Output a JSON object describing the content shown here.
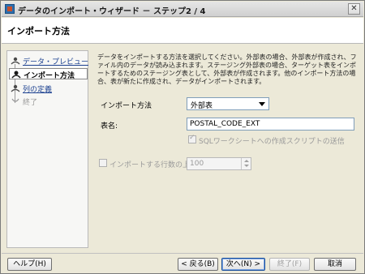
{
  "window": {
    "title": "データのインポート・ウィザード － ステップ2 / 4",
    "close_glyph": "✕"
  },
  "header": {
    "title": "インポート方法"
  },
  "steps": [
    {
      "label": "データ・プレビュー",
      "state": "link"
    },
    {
      "label": "インポート方法",
      "state": "current"
    },
    {
      "label": "列の定義",
      "state": "link"
    },
    {
      "label": "終了",
      "state": "disabled"
    }
  ],
  "content": {
    "description": "データをインポートする方法を選択してください。外部表の場合、外部表が作成され、ファイル内のデータが読み込まれます。ステージング外部表の場合、ターゲット表をインポートするためのステージング表として、外部表が作成されます。他のインポート方法の場合、表が新たに作成され、データがインポートされます。",
    "import_method_label": "インポート方法",
    "import_method_value": "外部表",
    "table_name_label": "表名:",
    "table_name_value": "POSTAL_CODE_EXT",
    "send_script_label": "SQLワークシートへの作成スクリプトの送信",
    "row_limit_label": "インポートする行数の上限:",
    "row_limit_value": "100"
  },
  "buttons": {
    "help": "ヘルプ(H)",
    "back": "< 戻る(B)",
    "next": "次へ(N) >",
    "finish": "終了(F)",
    "cancel": "取消"
  }
}
